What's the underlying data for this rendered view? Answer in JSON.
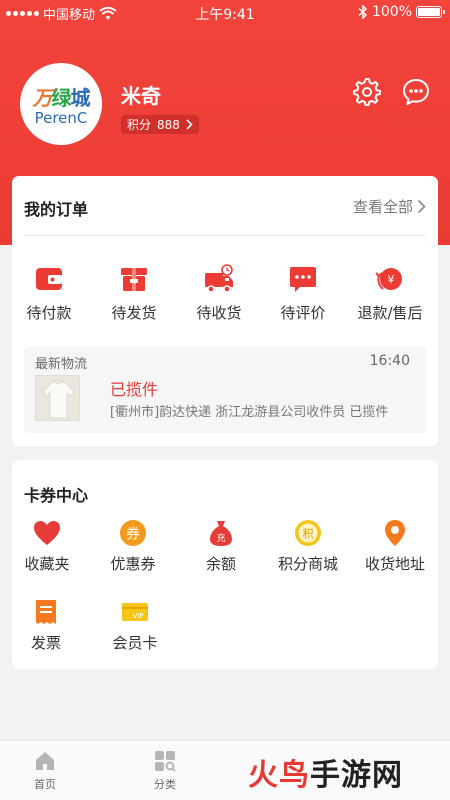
{
  "status_bar": {
    "carrier": "中国移动",
    "time": "上午9:41",
    "battery": "100%"
  },
  "colors": {
    "accent": "#ec3b34",
    "accent_orange": "#f39a1e",
    "bg": "#f2f2f2"
  },
  "profile": {
    "logo_cn_1": "万",
    "logo_cn_2": "绿",
    "logo_cn_3": "城",
    "logo_en": "PerenC",
    "name": "米奇",
    "points_label": "积分",
    "points_value": "888",
    "settings_icon": "gear-icon",
    "message_icon": "chat-bubble-icon"
  },
  "orders": {
    "title": "我的订单",
    "view_all": "查看全部",
    "items": [
      {
        "label": "待付款",
        "icon": "wallet-icon"
      },
      {
        "label": "待发货",
        "icon": "package-icon"
      },
      {
        "label": "待收货",
        "icon": "truck-icon"
      },
      {
        "label": "待评价",
        "icon": "comment-icon"
      },
      {
        "label": "退款/售后",
        "icon": "refund-icon"
      }
    ],
    "logistics": {
      "title": "最新物流",
      "time": "16:40",
      "status": "已揽件",
      "detail": "[衢州市]韵达快递 浙江龙游县公司收件员 已揽件"
    }
  },
  "coupons": {
    "title": "卡券中心",
    "items": [
      {
        "label": "收藏夹",
        "icon": "heart-icon"
      },
      {
        "label": "优惠券",
        "icon": "coupon-icon",
        "glyph": "券"
      },
      {
        "label": "余额",
        "icon": "money-bag-icon",
        "glyph": "充"
      },
      {
        "label": "积分商城",
        "icon": "points-coin-icon",
        "glyph": "积"
      },
      {
        "label": "收货地址",
        "icon": "location-pin-icon"
      },
      {
        "label": "发票",
        "icon": "invoice-icon"
      },
      {
        "label": "会员卡",
        "icon": "vip-card-icon",
        "glyph": "VIP"
      }
    ]
  },
  "bottom_nav": {
    "items": [
      {
        "label": "首页",
        "icon": "home-icon"
      },
      {
        "label": "分类",
        "icon": "category-icon"
      }
    ]
  },
  "watermark": {
    "part1": "火鸟",
    "part2": "手游网"
  }
}
